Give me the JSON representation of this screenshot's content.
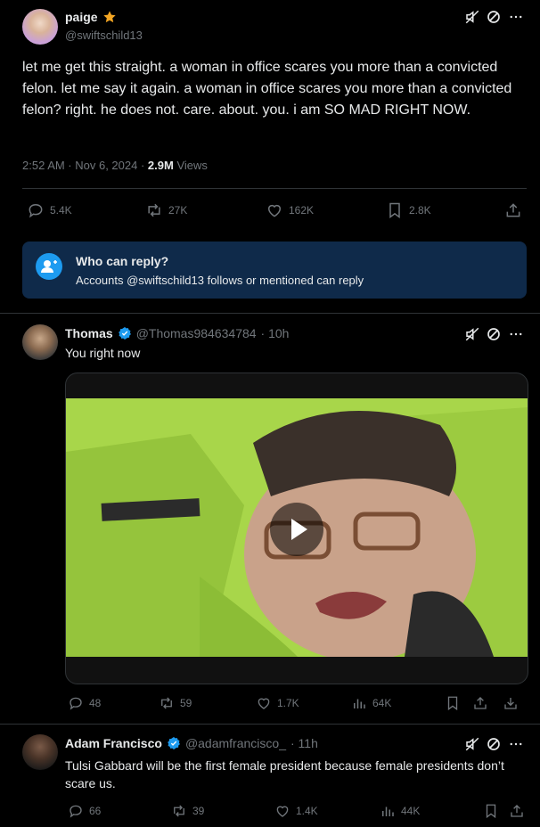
{
  "main_post": {
    "author_name": "paige",
    "author_handle": "@swiftschild13",
    "text": "let me get this straight. a woman in office scares you more than a convicted felon. let me say it again. a woman in office scares you more than a convicted felon? right. he does not. care. about. you. i am SO MAD RIGHT NOW.",
    "timestamp": "2:52 AM · Nov 6, 2024 · ",
    "views_count": "2.9M",
    "views_label": "Views",
    "stats": {
      "replies": "5.4K",
      "reposts": "27K",
      "likes": "162K",
      "bookmarks": "2.8K"
    }
  },
  "reply_restriction": {
    "title": "Who can reply?",
    "subtitle": "Accounts @swiftschild13 follows or mentioned can reply"
  },
  "replies": [
    {
      "author_name": "Thomas",
      "author_handle": "@Thomas984634784",
      "time": "· 10h",
      "text": "You right now",
      "stats": {
        "replies": "48",
        "reposts": "59",
        "likes": "1.7K",
        "views": "64K"
      }
    },
    {
      "author_name": "Adam Francisco",
      "author_handle": "@adamfrancisco_",
      "time": "· 11h",
      "text": "Tulsi Gabbard will be the first female president because female presidents don’t scare us.",
      "stats": {
        "replies": "66",
        "reposts": "39",
        "likes": "1.4K",
        "views": "44K"
      }
    }
  ],
  "colors": {
    "accent": "#1d9bf0",
    "star": "#f4a623",
    "muted": "#71767b",
    "restriction_bg": "#0f2a4a"
  },
  "icons": [
    "mute-icon",
    "block-icon",
    "more-icon",
    "reply-icon",
    "repost-icon",
    "like-icon",
    "bookmark-icon",
    "share-icon",
    "views-icon",
    "download-icon",
    "verified-icon",
    "star-icon",
    "play-icon",
    "people-icon"
  ]
}
